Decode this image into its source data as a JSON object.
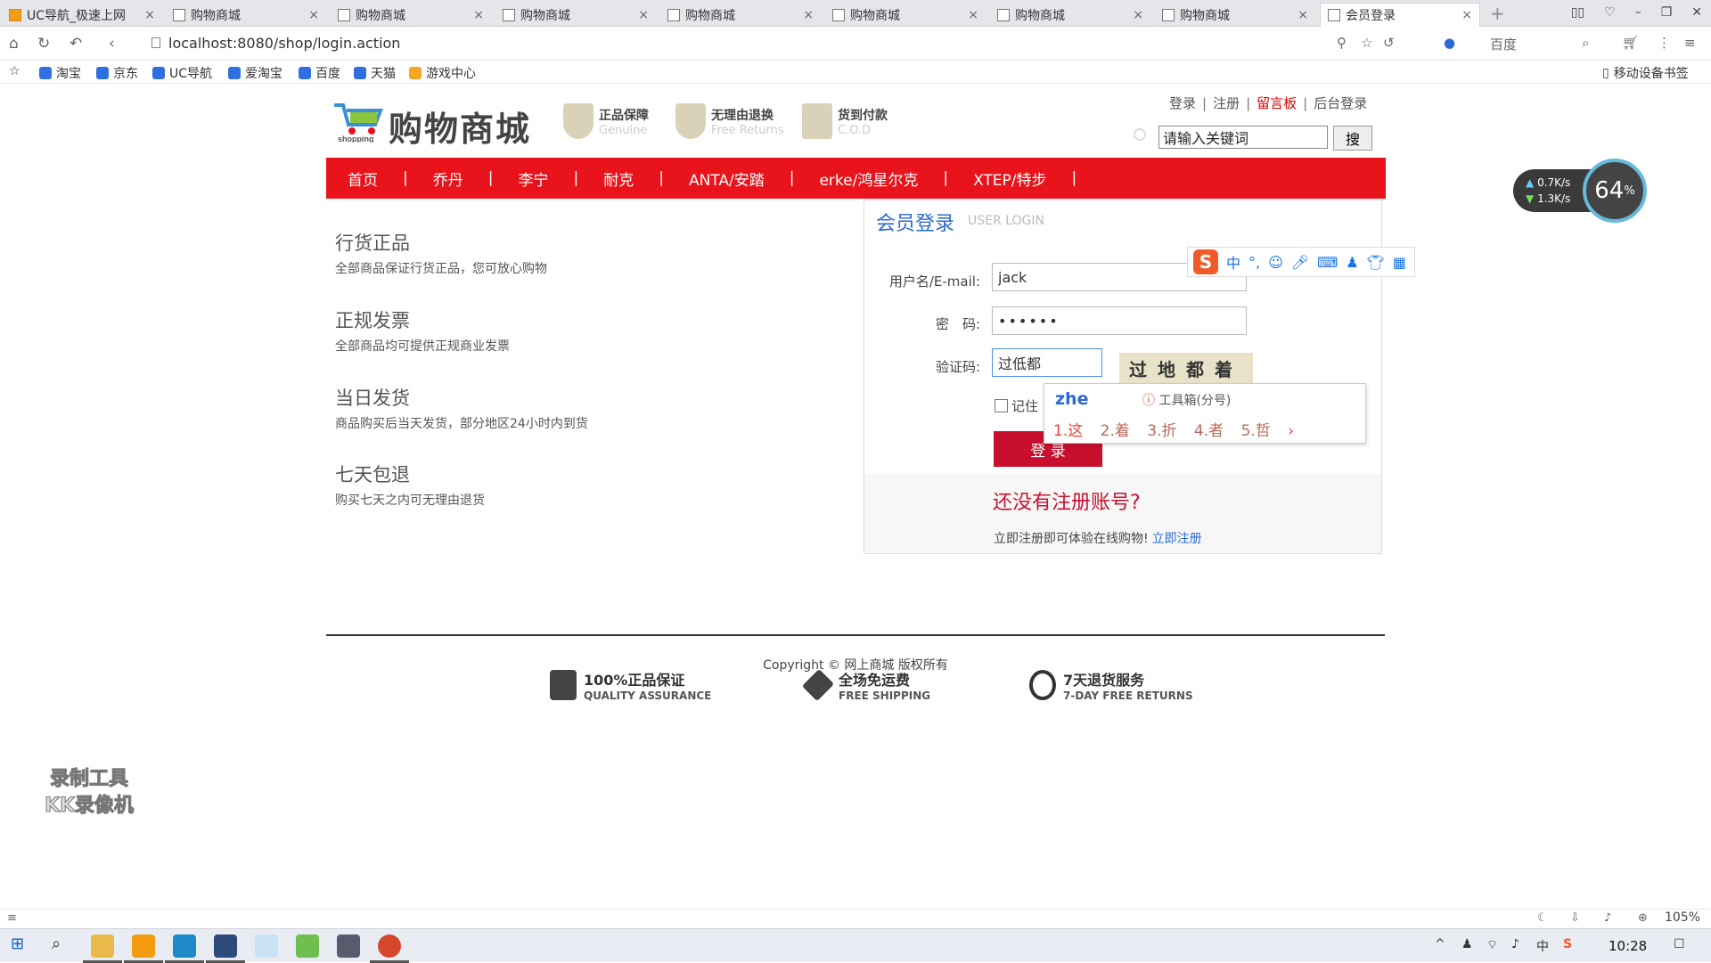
{
  "browser": {
    "tabs": [
      {
        "title": "UC导航_极速上网",
        "icon": "uc-logo-icon",
        "active": false
      },
      {
        "title": "购物商城",
        "icon": "page-icon",
        "active": false
      },
      {
        "title": "购物商城",
        "icon": "page-icon",
        "active": false
      },
      {
        "title": "购物商城",
        "icon": "page-icon",
        "active": false
      },
      {
        "title": "购物商城",
        "icon": "page-icon",
        "active": false
      },
      {
        "title": "购物商城",
        "icon": "page-icon",
        "active": false
      },
      {
        "title": "购物商城",
        "icon": "page-icon",
        "active": false
      },
      {
        "title": "购物商城",
        "icon": "page-icon",
        "active": false
      },
      {
        "title": "会员登录",
        "icon": "page-icon",
        "active": true
      }
    ],
    "url": "localhost:8080/shop/login.action",
    "search_engine": "百度",
    "bookmarks": [
      "淘宝",
      "京东",
      "UC导航",
      "爱淘宝",
      "百度",
      "天猫",
      "游戏中心"
    ],
    "mobile_bookmarks": "移动设备书签",
    "zoom": "105%"
  },
  "site": {
    "logo_text": "购物商城",
    "logo_sub": "shopping",
    "badges": [
      {
        "cn": "正品保障",
        "en": "Genuine"
      },
      {
        "cn": "无理由退换",
        "en": "Free Returns"
      },
      {
        "cn": "货到付款",
        "en": "C.O.D"
      }
    ],
    "top_links": {
      "login": "登录",
      "register": "注册",
      "guestbook": "留言板",
      "admin": "后台登录",
      "sep": "|"
    },
    "search": {
      "value": "请输入关键词",
      "button": "搜"
    },
    "nav": [
      "首页",
      "乔丹",
      "李宁",
      "耐克",
      "ANTA/安踏",
      "erke/鸿星尔克",
      "XTEP/特步"
    ],
    "nav_sep": "|",
    "features": [
      {
        "title": "行货正品",
        "desc": "全部商品保证行货正品，您可放心购物"
      },
      {
        "title": "正规发票",
        "desc": "全部商品均可提供正规商业发票"
      },
      {
        "title": "当日发货",
        "desc": "商品购买后当天发货，部分地区24小时内到货"
      },
      {
        "title": "七天包退",
        "desc": "购买七天之内可无理由退货"
      }
    ]
  },
  "login": {
    "title": "会员登录",
    "title_en": "USER LOGIN",
    "username_label": "用户名/E-mail:",
    "username_value": "jack",
    "password_label": "密　码:",
    "password_value": "••••••",
    "captcha_label": "验证码:",
    "captcha_value": "过低都",
    "captcha_image_text": "过地都着",
    "remember_label": "记住",
    "login_button": "登 录",
    "no_account": "还没有注册账号?",
    "register_prompt": "立即注册即可体验在线购物!",
    "register_link": "立即注册"
  },
  "ime": {
    "composition": "zhe",
    "toolbox": "工具箱(分号)",
    "candidates": [
      "1.这",
      "2.着",
      "3.折",
      "4.者",
      "5.哲"
    ],
    "toolbar_label": "中"
  },
  "guarantees": [
    {
      "cn": "100%正品保证",
      "en": "QUALITY ASSURANCE",
      "icon": "shield-icon"
    },
    {
      "cn": "全场免运费",
      "en": "FREE SHIPPING",
      "icon": "box-icon"
    },
    {
      "cn": "7天退货服务",
      "en": "7-DAY FREE RETURNS",
      "icon": "clock-icon"
    }
  ],
  "copyright": "Copyright © 网上商城 版权所有",
  "overlay": {
    "speed_up": "0.7K/s",
    "speed_down": "1.3K/s",
    "memory": "64",
    "memory_unit": "%",
    "watermark_line1": "录制工具",
    "watermark_line2": "KK录像机"
  },
  "taskbar": {
    "time": "10:28"
  },
  "colors": {
    "nav_red": "#e8131b",
    "login_blue": "#2a6ad5",
    "button_red": "#c8102e"
  }
}
